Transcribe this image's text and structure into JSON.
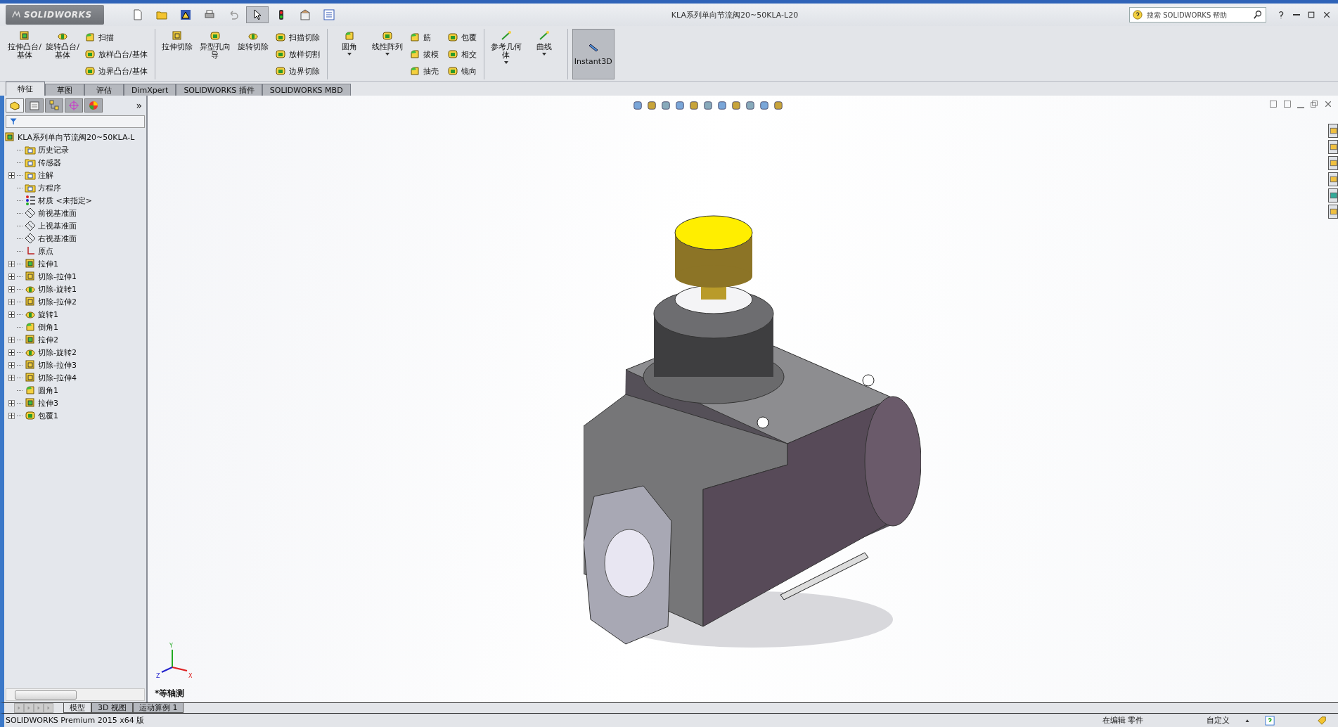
{
  "app": {
    "logo": "SOLIDWORKS",
    "title": "KLA系列单向节流阀20~50KLA-L20",
    "search": {
      "placeholder": "搜索 SOLIDWORKS 帮助"
    }
  },
  "quick_tools": [
    {
      "kind": "new",
      "selected": false
    },
    {
      "kind": "open",
      "selected": false
    },
    {
      "kind": "save",
      "selected": false
    },
    {
      "kind": "print",
      "selected": false
    },
    {
      "kind": "undo",
      "selected": false
    },
    {
      "kind": "select",
      "selected": true
    },
    {
      "kind": "rebuild",
      "selected": false
    },
    {
      "kind": "options",
      "selected": false
    },
    {
      "kind": "list",
      "selected": false
    }
  ],
  "ribbon": [
    {
      "big": [
        {
          "label": "拉伸凸台/基体",
          "kind": "extrude"
        },
        {
          "label": "旋转凸台/基体",
          "kind": "revolve"
        }
      ],
      "small": [
        {
          "label": "扫描",
          "kind": "sweep"
        },
        {
          "label": "放样凸台/基体",
          "kind": "loft"
        },
        {
          "label": "边界凸台/基体",
          "kind": "boundary"
        }
      ]
    },
    {
      "big": [
        {
          "label": "拉伸切除",
          "kind": "cut"
        },
        {
          "label": "异型孔向导",
          "kind": "hole"
        },
        {
          "label": "旋转切除",
          "kind": "revcut"
        }
      ],
      "small": [
        {
          "label": "扫描切除",
          "kind": "sweepcut"
        },
        {
          "label": "放样切割",
          "kind": "loftcut"
        },
        {
          "label": "边界切除",
          "kind": "boundary"
        }
      ]
    },
    {
      "big": [
        {
          "label": "圆角",
          "kind": "fillet",
          "dropdown": true
        },
        {
          "label": "线性阵列",
          "kind": "pattern",
          "dropdown": true
        }
      ],
      "small": [
        {
          "label": "筋",
          "kind": "rib"
        },
        {
          "label": "拔模",
          "kind": "draft"
        },
        {
          "label": "抽壳",
          "kind": "shell"
        },
        {
          "label": "包覆",
          "kind": "wrap"
        },
        {
          "label": "相交",
          "kind": "intersect"
        },
        {
          "label": "镜向",
          "kind": "mirror"
        }
      ]
    },
    {
      "big": [
        {
          "label": "参考几何体",
          "kind": "refgeom",
          "dropdown": true
        },
        {
          "label": "曲线",
          "kind": "curve",
          "dropdown": true
        }
      ]
    }
  ],
  "instant3d": {
    "label": "Instant3D",
    "selected": true
  },
  "command_tabs": [
    {
      "label": "特征",
      "selected": true
    },
    {
      "label": "草图",
      "selected": false
    },
    {
      "label": "评估",
      "selected": false
    },
    {
      "label": "DimXpert",
      "selected": false
    },
    {
      "label": "SOLIDWORKS 插件",
      "selected": false
    },
    {
      "label": "SOLIDWORKS MBD",
      "selected": false
    }
  ],
  "panel_tabs": [
    {
      "kind": "tree",
      "selected": true
    },
    {
      "kind": "property",
      "selected": false
    },
    {
      "kind": "config",
      "selected": false
    },
    {
      "kind": "dim",
      "selected": false
    },
    {
      "kind": "display",
      "selected": false
    }
  ],
  "panel_more": "»",
  "tree": {
    "label": "KLA系列单向节流阀20~50KLA-L",
    "kind": "part",
    "children": [
      {
        "label": "历史记录",
        "kind": "history",
        "expandable": false
      },
      {
        "label": "传感器",
        "kind": "sensor",
        "expandable": false
      },
      {
        "label": "注解",
        "kind": "annotation",
        "expandable": true
      },
      {
        "label": "方程序",
        "kind": "equation",
        "expandable": false
      },
      {
        "label": "材质 <未指定>",
        "kind": "material",
        "expandable": false
      },
      {
        "label": "前视基准面",
        "kind": "plane",
        "expandable": false
      },
      {
        "label": "上视基准面",
        "kind": "plane",
        "expandable": false
      },
      {
        "label": "右视基准面",
        "kind": "plane",
        "expandable": false
      },
      {
        "label": "原点",
        "kind": "origin",
        "expandable": false
      },
      {
        "label": "拉伸1",
        "kind": "extrude",
        "expandable": true
      },
      {
        "label": "切除-拉伸1",
        "kind": "cut",
        "expandable": true
      },
      {
        "label": "切除-旋转1",
        "kind": "revcut",
        "expandable": true
      },
      {
        "label": "切除-拉伸2",
        "kind": "cut",
        "expandable": true
      },
      {
        "label": "旋转1",
        "kind": "revolve",
        "expandable": true
      },
      {
        "label": "倒角1",
        "kind": "fillet",
        "expandable": false
      },
      {
        "label": "拉伸2",
        "kind": "extrude",
        "expandable": true
      },
      {
        "label": "切除-旋转2",
        "kind": "revcut",
        "expandable": true
      },
      {
        "label": "切除-拉伸3",
        "kind": "cut",
        "expandable": true
      },
      {
        "label": "切除-拉伸4",
        "kind": "cut",
        "expandable": true
      },
      {
        "label": "圆角1",
        "kind": "fillet",
        "expandable": false
      },
      {
        "label": "拉伸3",
        "kind": "extrude",
        "expandable": true
      },
      {
        "label": "包覆1",
        "kind": "wrap",
        "expandable": true
      }
    ]
  },
  "viewport": {
    "view_name": "*等轴测",
    "triad": {
      "x": "X",
      "y": "Y",
      "z": "Z"
    }
  },
  "bottom_tabs": [
    {
      "label": "模型",
      "selected": true
    },
    {
      "label": "3D 视图",
      "selected": false
    },
    {
      "label": "运动算例 1",
      "selected": false
    }
  ],
  "status_bar": {
    "product": "SOLIDWORKS Premium 2015 x64 版",
    "mode": "在编辑 零件",
    "units": "自定义"
  }
}
